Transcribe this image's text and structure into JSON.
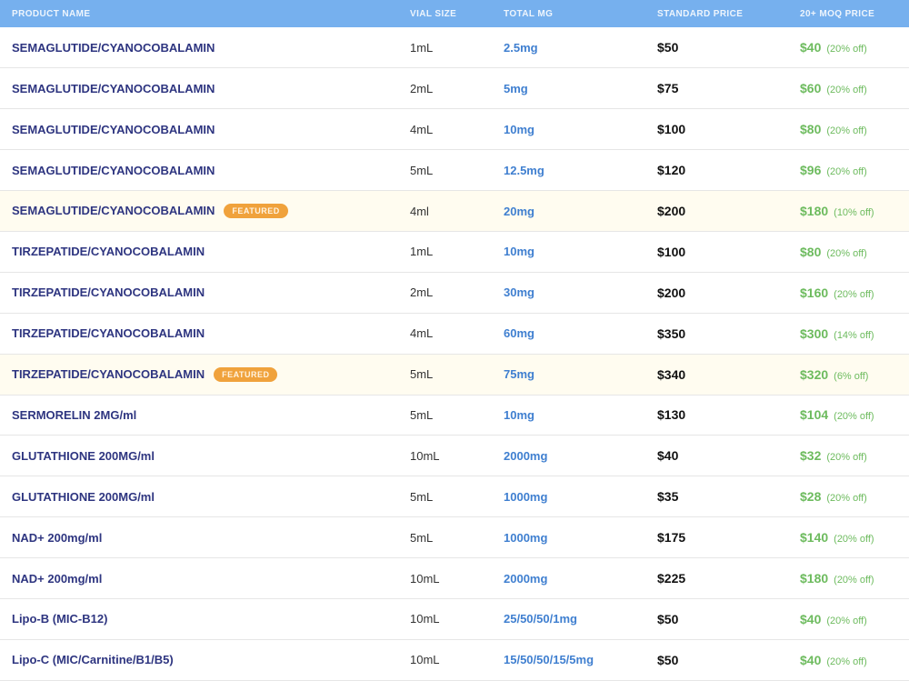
{
  "headers": {
    "name": "PRODUCT NAME",
    "vial": "VIAL SIZE",
    "mg": "TOTAL MG",
    "std": "STANDARD PRICE",
    "moq": "20+ MOQ PRICE"
  },
  "featured_label": "FEATURED",
  "rows": [
    {
      "name": "SEMAGLUTIDE/CYANOCOBALAMIN",
      "vial": "1mL",
      "mg": "2.5mg",
      "std": "$50",
      "moq": "$40",
      "off": "(20% off)",
      "featured": false
    },
    {
      "name": "SEMAGLUTIDE/CYANOCOBALAMIN",
      "vial": "2mL",
      "mg": "5mg",
      "std": "$75",
      "moq": "$60",
      "off": "(20% off)",
      "featured": false
    },
    {
      "name": "SEMAGLUTIDE/CYANOCOBALAMIN",
      "vial": "4mL",
      "mg": "10mg",
      "std": "$100",
      "moq": "$80",
      "off": "(20% off)",
      "featured": false
    },
    {
      "name": "SEMAGLUTIDE/CYANOCOBALAMIN",
      "vial": "5mL",
      "mg": "12.5mg",
      "std": "$120",
      "moq": "$96",
      "off": "(20% off)",
      "featured": false
    },
    {
      "name": "SEMAGLUTIDE/CYANOCOBALAMIN",
      "vial": "4ml",
      "mg": "20mg",
      "std": "$200",
      "moq": "$180",
      "off": "(10% off)",
      "featured": true
    },
    {
      "name": "TIRZEPATIDE/CYANOCOBALAMIN",
      "vial": "1mL",
      "mg": "10mg",
      "std": "$100",
      "moq": "$80",
      "off": "(20% off)",
      "featured": false
    },
    {
      "name": "TIRZEPATIDE/CYANOCOBALAMIN",
      "vial": "2mL",
      "mg": "30mg",
      "std": "$200",
      "moq": "$160",
      "off": "(20% off)",
      "featured": false
    },
    {
      "name": "TIRZEPATIDE/CYANOCOBALAMIN",
      "vial": "4mL",
      "mg": "60mg",
      "std": "$350",
      "moq": "$300",
      "off": "(14% off)",
      "featured": false
    },
    {
      "name": "TIRZEPATIDE/CYANOCOBALAMIN",
      "vial": "5mL",
      "mg": "75mg",
      "std": "$340",
      "moq": "$320",
      "off": "(6% off)",
      "featured": true
    },
    {
      "name": "SERMORELIN 2MG/ml",
      "vial": "5mL",
      "mg": "10mg",
      "std": "$130",
      "moq": "$104",
      "off": "(20% off)",
      "featured": false
    },
    {
      "name": "GLUTATHIONE 200MG/ml",
      "vial": "10mL",
      "mg": "2000mg",
      "std": "$40",
      "moq": "$32",
      "off": "(20% off)",
      "featured": false
    },
    {
      "name": "GLUTATHIONE 200MG/ml",
      "vial": "5mL",
      "mg": "1000mg",
      "std": "$35",
      "moq": "$28",
      "off": "(20% off)",
      "featured": false
    },
    {
      "name": "NAD+ 200mg/ml",
      "vial": "5mL",
      "mg": "1000mg",
      "std": "$175",
      "moq": "$140",
      "off": "(20% off)",
      "featured": false
    },
    {
      "name": "NAD+ 200mg/ml",
      "vial": "10mL",
      "mg": "2000mg",
      "std": "$225",
      "moq": "$180",
      "off": "(20% off)",
      "featured": false
    },
    {
      "name": "Lipo-B (MIC-B12)",
      "vial": "10mL",
      "mg": "25/50/50/1mg",
      "std": "$50",
      "moq": "$40",
      "off": "(20% off)",
      "featured": false
    },
    {
      "name": "Lipo-C (MIC/Carnitine/B1/B5)",
      "vial": "10mL",
      "mg": "15/50/50/15/5mg",
      "std": "$50",
      "moq": "$40",
      "off": "(20% off)",
      "featured": false
    }
  ]
}
